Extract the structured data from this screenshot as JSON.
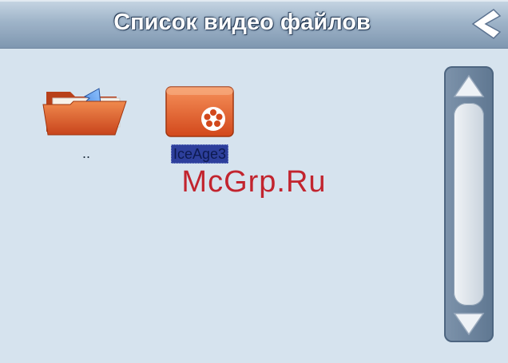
{
  "header": {
    "title": "Список видео файлов",
    "back_icon": "chevron-left-icon"
  },
  "files": [
    {
      "label": "..",
      "icon": "folder-up-icon",
      "selected": false
    },
    {
      "label": "IceAge3",
      "icon": "video-file-icon",
      "selected": true
    }
  ],
  "scrollbar": {
    "up_icon": "triangle-up-icon",
    "down_icon": "triangle-down-icon"
  },
  "watermark": "McGrp.Ru",
  "colors": {
    "background": "#d6e3ee",
    "header": "#9fb4c9",
    "icon_orange": "#e2622a",
    "selection": "#2d3f9c",
    "watermark": "#c0101a"
  }
}
